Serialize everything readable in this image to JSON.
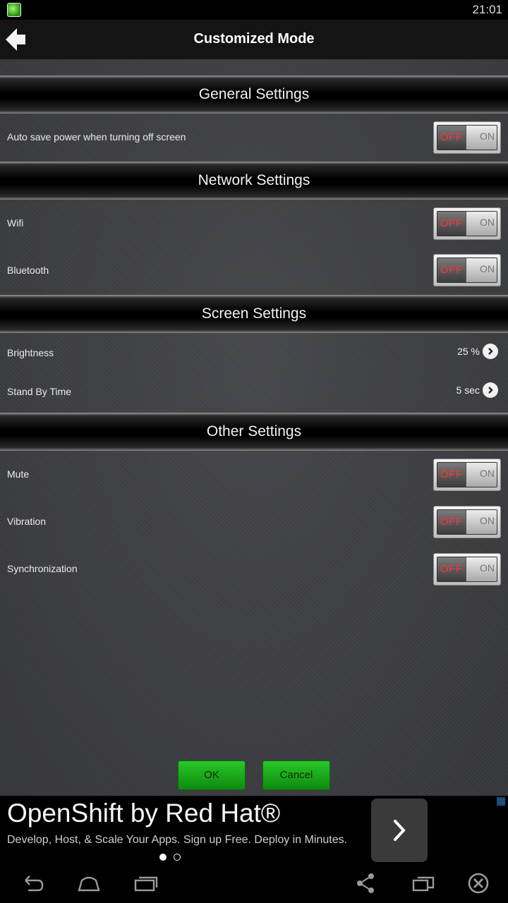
{
  "status_bar": {
    "time": "21:01",
    "app_icon": "app-leaf-icon"
  },
  "header": {
    "title": "Customized Mode",
    "back_icon": "back-arrow-icon"
  },
  "sections": {
    "general": {
      "title": "General Settings"
    },
    "network": {
      "title": "Network Settings"
    },
    "screen": {
      "title": "Screen Settings"
    },
    "other": {
      "title": "Other Settings"
    }
  },
  "rows": {
    "auto_save": {
      "label": "Auto save power when turning off screen",
      "state": "OFF"
    },
    "wifi": {
      "label": "Wifi",
      "state": "OFF"
    },
    "bluetooth": {
      "label": "Bluetooth",
      "state": "OFF"
    },
    "brightness": {
      "label": "Brightness",
      "value": "25 %"
    },
    "standby": {
      "label": "Stand By Time",
      "value": "5 sec"
    },
    "mute": {
      "label": "Mute",
      "state": "OFF"
    },
    "vibration": {
      "label": "Vibration",
      "state": "OFF"
    },
    "sync": {
      "label": "Synchronization",
      "state": "OFF"
    }
  },
  "toggle_labels": {
    "off": "OFF",
    "on": "ON"
  },
  "buttons": {
    "ok": "OK",
    "cancel": "Cancel"
  },
  "ad": {
    "headline": "OpenShift by Red Hat®",
    "subtext": "Develop, Host, & Scale Your Apps. Sign up Free. Deploy in Minutes.",
    "action_icon": "chevron-right-icon",
    "page_count": 2,
    "current_page": 1
  },
  "nav_bar": {
    "icons": [
      "back-icon",
      "home-icon",
      "recent-apps-icon",
      "share-icon",
      "window-icon",
      "close-circle-icon"
    ]
  },
  "colors": {
    "toggle_off_text": "#ff3333",
    "button_green": "#1aa81a",
    "section_header_bg": "#000000"
  }
}
